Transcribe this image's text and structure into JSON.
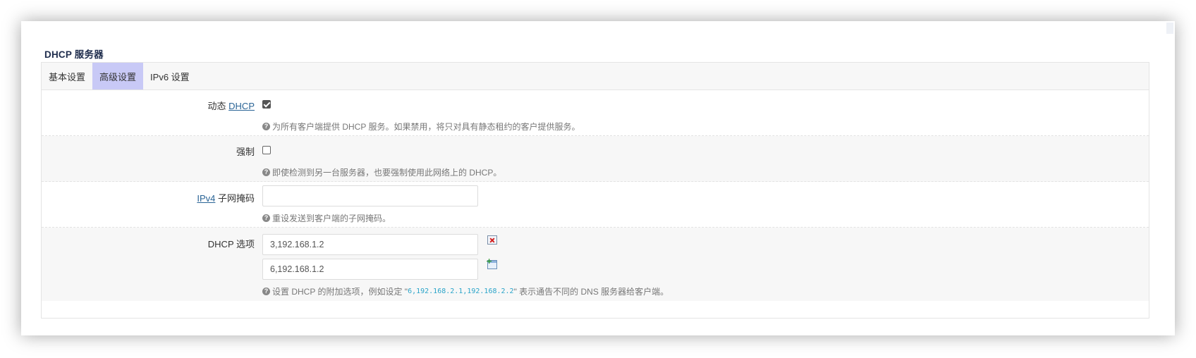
{
  "section": {
    "title": "DHCP 服务器"
  },
  "tabs": [
    {
      "label": "基本设置",
      "active": false
    },
    {
      "label": "高级设置",
      "active": true
    },
    {
      "label": "IPv6 设置",
      "active": false
    }
  ],
  "fields": {
    "dynamic_dhcp": {
      "label_prefix": "动态 ",
      "label_link": "DHCP",
      "checked": true,
      "help": "为所有客户端提供 DHCP 服务。如果禁用，将只对具有静态租约的客户提供服务。"
    },
    "force": {
      "label": "强制",
      "checked": false,
      "help": "即使检测到另一台服务器，也要强制使用此网络上的 DHCP。"
    },
    "ipv4_netmask": {
      "label_link": "IPv4",
      "label_suffix": " 子网掩码",
      "value": "",
      "help": "重设发送到客户端的子网掩码。"
    },
    "dhcp_options": {
      "label": "DHCP 选项",
      "values": [
        "3,192.168.1.2",
        "6,192.168.1.2"
      ],
      "help_prefix": "设置 DHCP 的附加选项，例如设定 \"",
      "help_code": "6,192.168.2.1,192.168.2.2",
      "help_suffix": "\" 表示通告不同的 DNS 服务器给客户端。"
    }
  },
  "icons": {
    "help": "question-circle-icon",
    "remove": "remove-entry-icon",
    "add": "add-entry-icon"
  },
  "colors": {
    "active_tab": "#c8c9f6",
    "link": "#2a6496",
    "code": "#2aa4c9"
  }
}
